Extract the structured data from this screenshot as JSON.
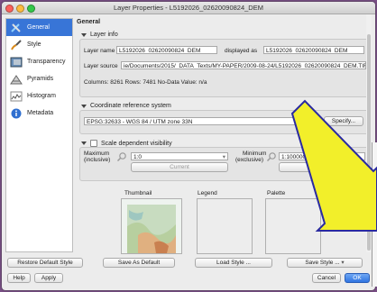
{
  "window": {
    "title": "Layer Properties - L5192026_02620090824_DEM"
  },
  "sidebar": {
    "items": [
      {
        "label": "General",
        "icon": "wrench-screwdriver-icon",
        "active": true
      },
      {
        "label": "Style",
        "icon": "paintbrush-icon",
        "active": false
      },
      {
        "label": "Transparency",
        "icon": "transparency-icon",
        "active": false
      },
      {
        "label": "Pyramids",
        "icon": "pyramid-icon",
        "active": false
      },
      {
        "label": "Histogram",
        "icon": "histogram-icon",
        "active": false
      },
      {
        "label": "Metadata",
        "icon": "info-icon",
        "active": false
      }
    ]
  },
  "general": {
    "title": "General",
    "layer_info": {
      "header": "Layer info",
      "layer_name_label": "Layer name",
      "layer_name_value": "L5192026_02620090824_DEM",
      "displayed_as_label": "displayed as",
      "displayed_as_value": "L5192026_02620090824_DEM",
      "layer_source_label": "Layer source",
      "layer_source_value": "ie/Documents/2015/_DATA_Texts/MY-PAPER/2009-08-24/L5192026_02620090824_DEM.TIF",
      "stats": "Columns: 8261  Rows: 7481  No-Data Value: n/a"
    },
    "crs": {
      "header": "Coordinate reference system",
      "value": "EPSG:32633 - WGS 84 / UTM zone 33N",
      "specify_label": "Specify..."
    },
    "scale": {
      "header": "Scale dependent visibility",
      "max_label_1": "Maximum",
      "max_label_2": "(inclusive)",
      "max_value": "1:0",
      "min_label_1": "Minimum",
      "min_label_2": "(exclusive)",
      "min_value": "1:100000000",
      "current_label": "Current"
    },
    "previews": {
      "thumbnail_label": "Thumbnail",
      "legend_label": "Legend",
      "palette_label": "Palette"
    }
  },
  "footer": {
    "restore_default_style": "Restore Default Style",
    "save_as_default": "Save As Default",
    "load_style": "Load Style ...",
    "save_style": "Save Style ...",
    "help": "Help",
    "apply": "Apply",
    "cancel": "Cancel",
    "ok": "OK"
  },
  "colors": {
    "accent": "#3875d7",
    "arrow_fill": "#f2ef2a",
    "arrow_stroke": "#2a2aa0",
    "background": "#7a4f86"
  }
}
